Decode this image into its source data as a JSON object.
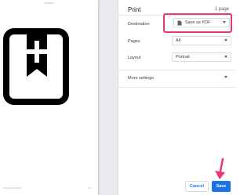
{
  "preview": {
    "header_text": "Untitled",
    "footer_left": "chrome://print/",
    "footer_right": "1/1"
  },
  "panel": {
    "title": "Print",
    "pages_count": "1 page",
    "destination": {
      "label": "Destination",
      "value": "Save as PDF"
    },
    "pages": {
      "label": "Pages",
      "value": "All"
    },
    "layout": {
      "label": "Layout",
      "value": "Portrait"
    },
    "more_settings": "More settings"
  },
  "buttons": {
    "cancel": "Cancel",
    "save": "Save"
  },
  "colors": {
    "accent": "#1a73e8",
    "highlight": "#e8367a"
  }
}
